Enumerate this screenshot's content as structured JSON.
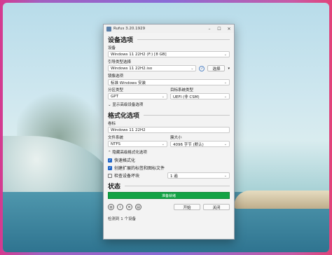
{
  "window": {
    "title": "Rufus 3.20.1929",
    "minimize": "–",
    "maximize": "☐",
    "close": "✕"
  },
  "device_section": {
    "heading": "设备选项",
    "device_label": "设备",
    "device_value": "Windows 11 22H2 (F:) [8 GB]",
    "boot_label": "引导类型选择",
    "boot_value": "Windows 11 22H2.iso",
    "select_button": "选择",
    "image_option_label": "镜像选项",
    "image_option_value": "标准 Windows 安装",
    "partition_label": "分区类型",
    "partition_value": "GPT",
    "target_label": "目标系统类型",
    "target_value": "UEFI (非 CSM)",
    "advanced_toggle": "显示高级设备选项"
  },
  "format_section": {
    "heading": "格式化选项",
    "volume_label": "卷标",
    "volume_value": "Windows 11 22H2",
    "fs_label": "文件系统",
    "fs_value": "NTFS",
    "cluster_label": "簇大小",
    "cluster_value": "4096 字节 (默认)",
    "advanced_toggle": "隐藏高级格式化选项",
    "quick_format": "快速格式化",
    "extended_label": "创建扩展的标签和图标文件",
    "bad_blocks": "检查设备坏块",
    "passes_value": "1 遍"
  },
  "status_section": {
    "heading": "状态",
    "progress_text": "准备就绪",
    "progress_color": "#12a344"
  },
  "footer": {
    "start_button": "开始",
    "close_button": "关闭",
    "status_text": "检测到 1 个设备"
  },
  "checks": {
    "quick_format": true,
    "extended_label": true,
    "bad_blocks": false
  }
}
